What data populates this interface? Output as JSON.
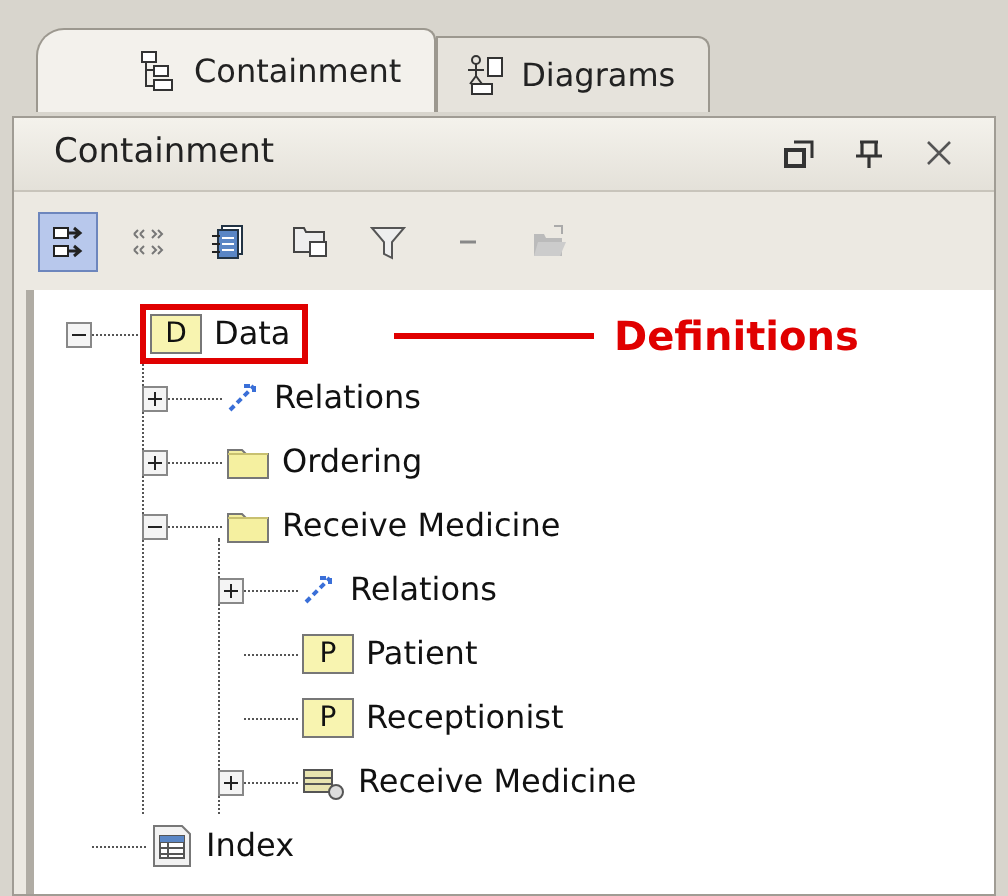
{
  "tabs": [
    {
      "label": "Containment",
      "selected": true
    },
    {
      "label": "Diagrams",
      "selected": false
    }
  ],
  "panel": {
    "title": "Containment"
  },
  "toolbar": [
    {
      "pressed": true
    },
    {
      "pressed": false
    },
    {
      "pressed": false
    },
    {
      "pressed": false
    },
    {
      "pressed": false
    },
    {
      "pressed": false
    },
    {
      "pressed": false
    }
  ],
  "tree": [
    {
      "label": "Data",
      "kind": "package",
      "badge": "D",
      "expanded": true,
      "annotated": true,
      "children": [
        {
          "label": "Relations",
          "kind": "relations",
          "expanded": false
        },
        {
          "label": "Ordering",
          "kind": "folder",
          "expanded": false
        },
        {
          "label": "Receive Medicine",
          "kind": "folder",
          "expanded": true,
          "children": [
            {
              "label": "Relations",
              "kind": "relations",
              "expanded": false
            },
            {
              "label": "Patient",
              "kind": "part",
              "badge": "P"
            },
            {
              "label": "Receptionist",
              "kind": "part",
              "badge": "P"
            },
            {
              "label": "Receive Medicine",
              "kind": "interaction",
              "expanded": false
            }
          ]
        }
      ]
    },
    {
      "label": "Index",
      "kind": "index"
    }
  ],
  "annotation": {
    "label": "Definitions"
  }
}
